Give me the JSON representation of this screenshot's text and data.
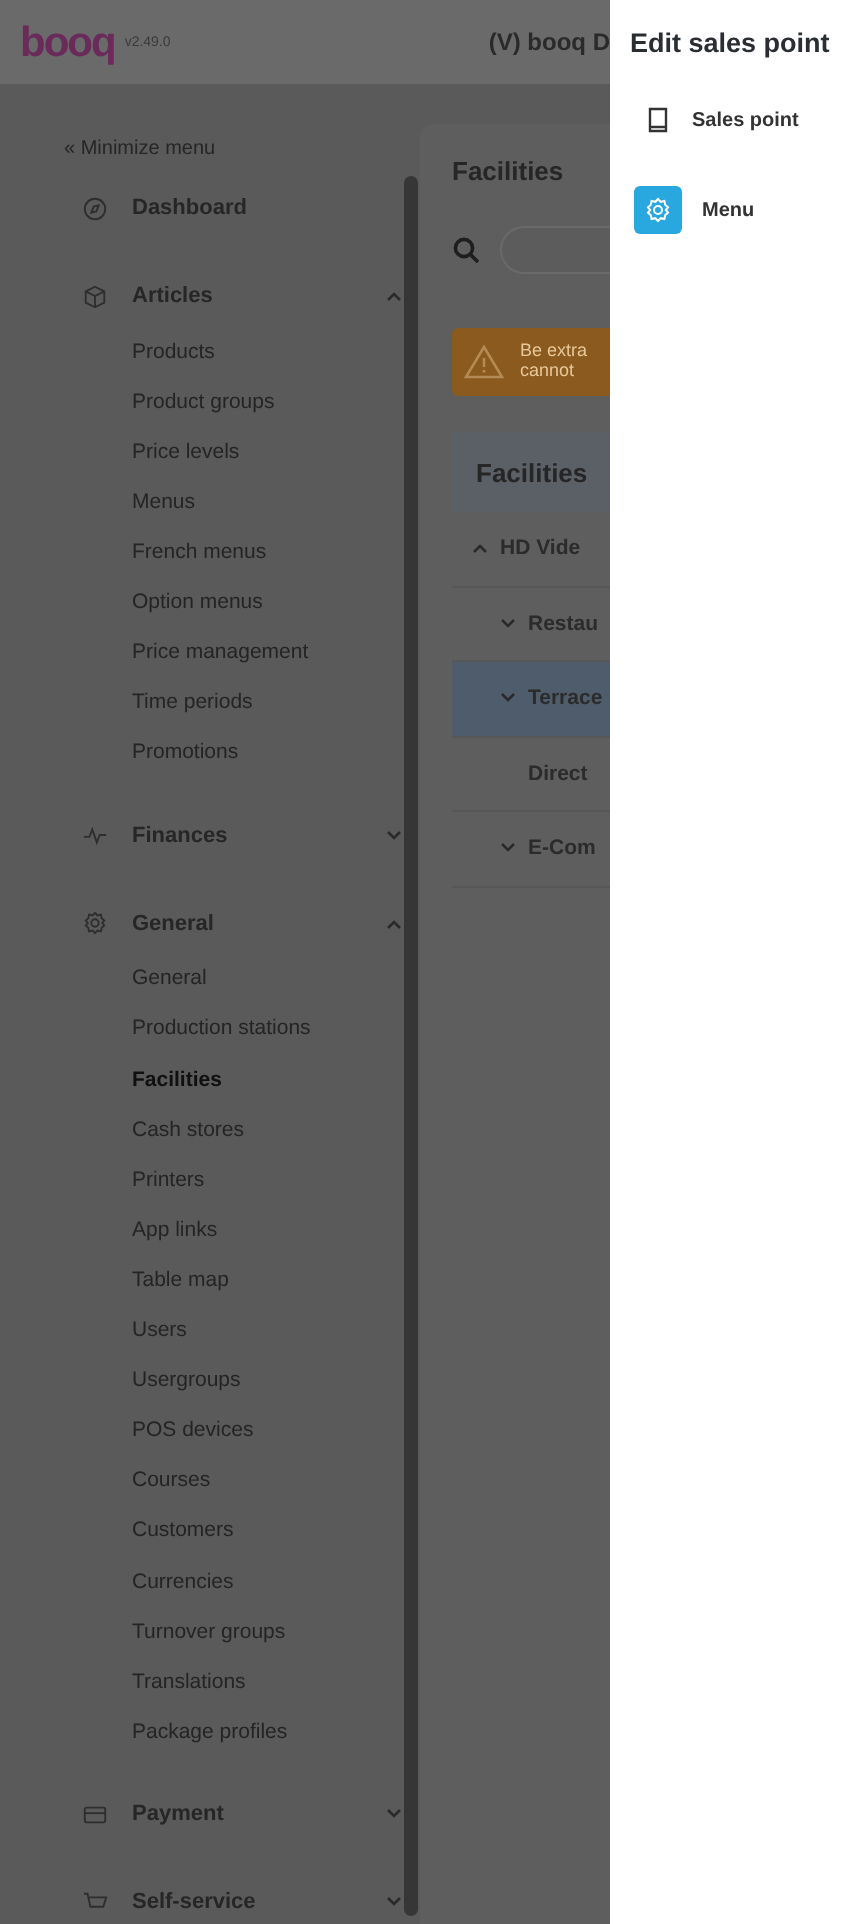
{
  "header": {
    "logo": "booq",
    "version": "v2.49.0",
    "venue": "(V) booq D"
  },
  "sidebar": {
    "minimize": "« Minimize menu",
    "groups": [
      {
        "kind": "dashboard",
        "label": "Dashboard"
      },
      {
        "kind": "box",
        "label": "Articles",
        "expanded": true,
        "items": [
          {
            "label": "Products",
            "selected": false
          },
          {
            "label": "Product groups",
            "selected": false
          },
          {
            "label": "Price levels",
            "selected": false
          },
          {
            "label": "Menus",
            "selected": false
          },
          {
            "label": "French menus",
            "selected": false
          },
          {
            "label": "Option menus",
            "selected": false
          },
          {
            "label": "Price management",
            "selected": false
          },
          {
            "label": "Time periods",
            "selected": false
          },
          {
            "label": "Promotions",
            "selected": false
          }
        ]
      },
      {
        "kind": "pulse",
        "label": "Finances",
        "expanded": false
      },
      {
        "kind": "gear",
        "label": "General",
        "expanded": true,
        "items": [
          {
            "label": "General",
            "selected": false
          },
          {
            "label": "Production stations",
            "selected": false
          },
          {
            "label": "Facilities",
            "selected": true
          },
          {
            "label": "Cash stores",
            "selected": false
          },
          {
            "label": "Printers",
            "selected": false
          },
          {
            "label": "App links",
            "selected": false
          },
          {
            "label": "Table map",
            "selected": false
          },
          {
            "label": "Users",
            "selected": false
          },
          {
            "label": "Usergroups",
            "selected": false
          },
          {
            "label": "POS devices",
            "selected": false
          },
          {
            "label": "Courses",
            "selected": false
          },
          {
            "label": "Customers",
            "selected": false
          },
          {
            "label": "Currencies",
            "selected": false
          },
          {
            "label": "Turnover groups",
            "selected": false
          },
          {
            "label": "Translations",
            "selected": false
          },
          {
            "label": "Package profiles",
            "selected": false
          }
        ]
      },
      {
        "kind": "card",
        "label": "Payment",
        "expanded": false
      },
      {
        "kind": "cart",
        "label": "Self-service",
        "expanded": false
      }
    ]
  },
  "content": {
    "title": "Facilities",
    "warning": [
      "Be extra",
      "cannot"
    ],
    "card_title": "Facilities",
    "tree": [
      {
        "label": "HD Vide",
        "expanded": true,
        "selected": false,
        "children": [
          {
            "label": "Restau",
            "expanded": false,
            "selected": false
          },
          {
            "label": "Terrace",
            "expanded": false,
            "selected": true
          },
          {
            "label": "Direct",
            "selected": false
          },
          {
            "label": "E-Com",
            "expanded": false,
            "selected": false
          }
        ]
      }
    ]
  },
  "panel": {
    "title": "Edit sales point",
    "items": [
      {
        "kind": "book",
        "label": "Sales point",
        "selected": false
      },
      {
        "kind": "gear",
        "label": "Menu",
        "selected": true
      }
    ]
  }
}
